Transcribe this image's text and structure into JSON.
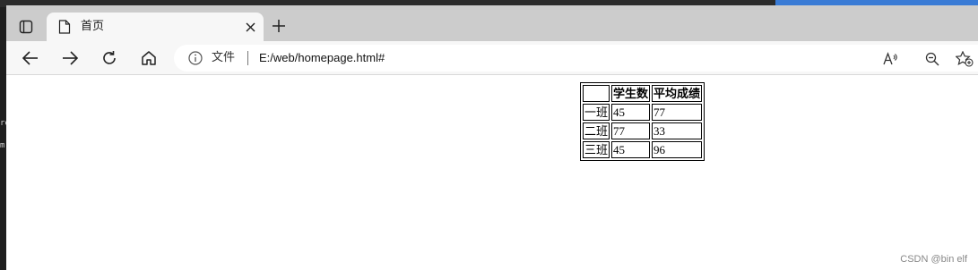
{
  "browser": {
    "tab": {
      "title": "首页"
    },
    "address": {
      "scheme_label": "文件",
      "url": "E:/web/homepage.html#"
    }
  },
  "table": {
    "headers": [
      "",
      "学生数",
      "平均成绩"
    ],
    "rows": [
      {
        "label": "一班",
        "students": "45",
        "average": "77"
      },
      {
        "label": "二班",
        "students": "77",
        "average": "33"
      },
      {
        "label": "三班",
        "students": "45",
        "average": "96"
      }
    ]
  },
  "watermark": "CSDN @bin elf"
}
